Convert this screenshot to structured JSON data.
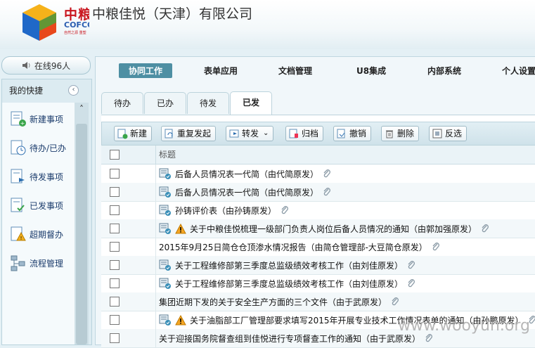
{
  "header": {
    "logo_cn": "中粮",
    "logo_en": "COFCO",
    "logo_sub": "自然之源 重塑",
    "company": "中粮佳悦（天津）有限公司"
  },
  "online": {
    "label": "在线96人"
  },
  "sidebar": {
    "title": "我的快捷",
    "items": [
      {
        "label": "新建事项",
        "icon": "new-item-icon"
      },
      {
        "label": "待办/已办",
        "icon": "pending-done-icon"
      },
      {
        "label": "待发事项",
        "icon": "to-send-icon"
      },
      {
        "label": "已发事项",
        "icon": "sent-icon"
      },
      {
        "label": "超期督办",
        "icon": "overdue-warning-icon"
      },
      {
        "label": "流程管理",
        "icon": "workflow-icon"
      }
    ]
  },
  "topnav": {
    "items": [
      {
        "label": "协同工作",
        "active": true
      },
      {
        "label": "表单应用"
      },
      {
        "label": "文档管理"
      },
      {
        "label": "U8集成"
      },
      {
        "label": "内部系统"
      },
      {
        "label": "个人设置"
      }
    ]
  },
  "tabs": [
    {
      "label": "待办"
    },
    {
      "label": "已办"
    },
    {
      "label": "待发"
    },
    {
      "label": "已发",
      "active": true
    }
  ],
  "toolbar": {
    "buttons": [
      {
        "label": "新建",
        "icon": "new-icon"
      },
      {
        "label": "重复发起",
        "icon": "repeat-icon"
      },
      {
        "label": "转发",
        "icon": "forward-icon"
      },
      {
        "label": "归档",
        "icon": "archive-icon"
      },
      {
        "label": "撤销",
        "icon": "revoke-icon"
      },
      {
        "label": "删除",
        "icon": "delete-icon"
      },
      {
        "label": "反选",
        "icon": "invert-select-icon"
      }
    ]
  },
  "grid": {
    "title_header": "标题",
    "rows": [
      {
        "text": "后备人员情况表一代简（由代简原发）",
        "doc_icon": true,
        "warn": false
      },
      {
        "text": "后备人员情况表一代简（由代简原发）",
        "doc_icon": true,
        "warn": false
      },
      {
        "text": "孙铸评价表（由孙铸原发）",
        "doc_icon": true,
        "warn": false
      },
      {
        "text": "关于中粮佳悦梳理一级部门负责人岗位后备人员情况的通知（由郭加强原发）",
        "doc_icon": true,
        "warn": true
      },
      {
        "text": "2015年9月25日简仓仓顶渗水情况报告（由简仓管理部-大豆简仓原发）",
        "doc_icon": false,
        "warn": false
      },
      {
        "text": "关于工程维修部第三季度总监级绩效考核工作（由刘佳原发）",
        "doc_icon": true,
        "warn": false
      },
      {
        "text": "关于工程维修部第三季度总监级绩效考核工作（由刘佳原发）",
        "doc_icon": true,
        "warn": false
      },
      {
        "text": "集团近期下发的关于安全生产方面的三个文件（由于武原发）",
        "doc_icon": false,
        "warn": false
      },
      {
        "text": "关于油脂部工厂管理部要求填写2015年开展专业技术工作情况表单的通知（由孙鹏原发）",
        "doc_icon": true,
        "warn": true
      },
      {
        "text": "关于迎接国务院督查组到佳悦进行专项督查工作的通知（由于武原发）",
        "doc_icon": false,
        "warn": false
      }
    ]
  },
  "watermark": "www.wooyun.org"
}
